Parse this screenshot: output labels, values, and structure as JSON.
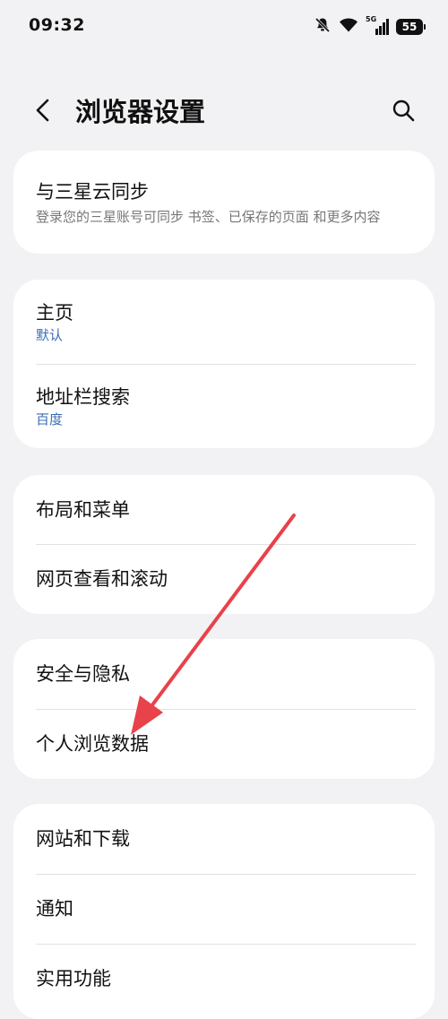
{
  "status_bar": {
    "time": "09:32",
    "network_label": "5G",
    "battery_level": "55",
    "icons": [
      "mute-bell-icon",
      "wifi-icon",
      "5g-signal-icon",
      "battery-icon"
    ]
  },
  "header": {
    "title": "浏览器设置",
    "back_icon": "chevron-left-icon",
    "search_icon": "search-icon"
  },
  "sections": {
    "sync": {
      "title": "与三星云同步",
      "description": "登录您的三星账号可同步 书签、已保存的页面 和更多内容"
    },
    "home": {
      "title": "主页",
      "value": "默认"
    },
    "address_bar": {
      "title": "地址栏搜索",
      "value": "百度"
    },
    "layout": {
      "title": "布局和菜单"
    },
    "scroll": {
      "title": "网页查看和滚动"
    },
    "security": {
      "title": "安全与隐私"
    },
    "personal_data": {
      "title": "个人浏览数据"
    },
    "sites_downloads": {
      "title": "网站和下载"
    },
    "notifications": {
      "title": "通知"
    },
    "utilities": {
      "title": "实用功能"
    }
  },
  "annotation": {
    "type": "red-arrow",
    "color": "#e8424a",
    "points_to": "个人浏览数据"
  },
  "colors": {
    "background": "#f2f2f4",
    "card": "#ffffff",
    "accent_value": "#3b6db4",
    "subtitle": "#777777"
  }
}
